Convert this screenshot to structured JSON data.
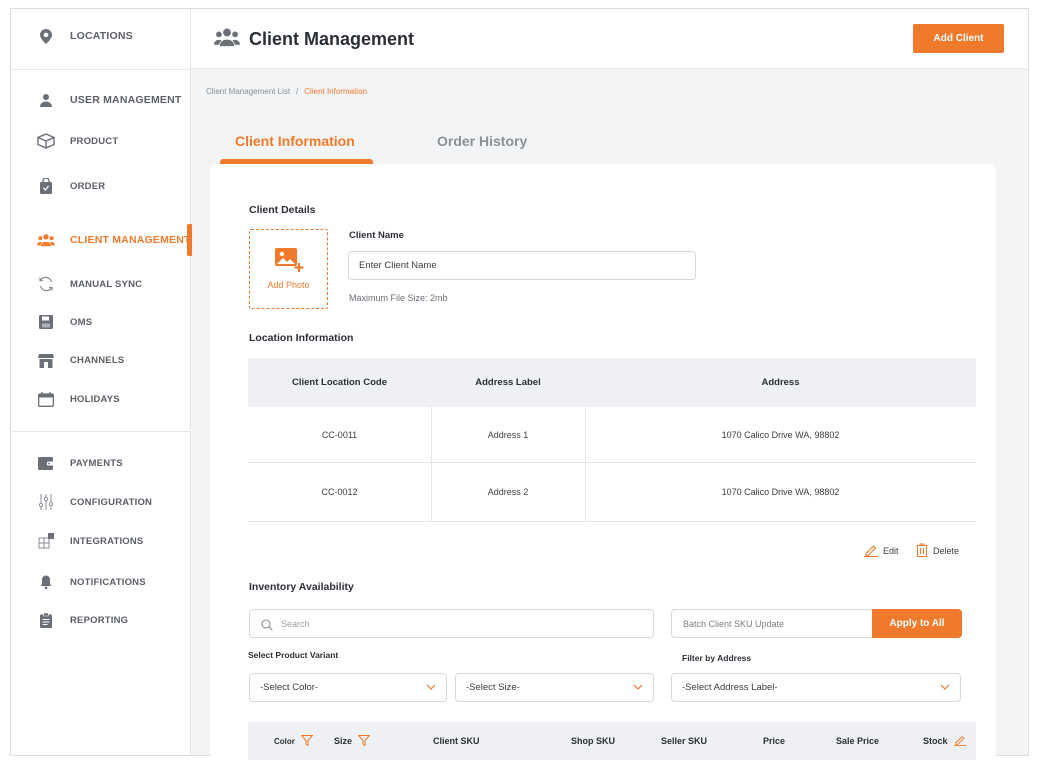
{
  "sidebar": {
    "items": [
      {
        "label": "LOCATIONS",
        "icon": "location-pin-icon"
      },
      {
        "label": "USER MANAGEMENT",
        "icon": "user-icon"
      },
      {
        "label": "PRODUCT",
        "icon": "box-icon"
      },
      {
        "label": "ORDER",
        "icon": "shopping-bag-icon"
      },
      {
        "label": "CLIENT MANAGEMENT",
        "icon": "group-icon",
        "active": true
      },
      {
        "label": "MANUAL SYNC",
        "icon": "sync-icon"
      },
      {
        "label": "OMS",
        "icon": "save-icon"
      },
      {
        "label": "CHANNELS",
        "icon": "store-icon"
      },
      {
        "label": "HOLIDAYS",
        "icon": "calendar-icon"
      },
      {
        "label": "PAYMENTS",
        "icon": "wallet-icon"
      },
      {
        "label": "CONFIGURATION",
        "icon": "sliders-icon"
      },
      {
        "label": "INTEGRATIONS",
        "icon": "puzzle-icon"
      },
      {
        "label": "NOTIFICATIONS",
        "icon": "bell-icon"
      },
      {
        "label": "REPORTING",
        "icon": "clipboard-icon"
      }
    ]
  },
  "header": {
    "title": "Client Management",
    "add_client_label": "Add Client"
  },
  "breadcrumb": {
    "parent": "Client Management List",
    "separator": "/",
    "current": "Client Information"
  },
  "tabs": [
    {
      "label": "Client Information",
      "active": true
    },
    {
      "label": "Order History",
      "active": false
    }
  ],
  "client_details": {
    "heading": "Client Details",
    "add_photo_label": "Add Photo",
    "name_label": "Client Name",
    "name_value": "Enter Client Name",
    "max_file_hint": "Maximum File Size: 2mb"
  },
  "location_info": {
    "heading": "Location Information",
    "columns": [
      "Client Location Code",
      "Address Label",
      "Address"
    ],
    "rows": [
      {
        "code": "CC-0011",
        "label": "Address 1",
        "address": "1070 Calico Drive WA, 98802"
      },
      {
        "code": "CC-0012",
        "label": "Address 2",
        "address": "1070 Calico Drive WA, 98802"
      }
    ],
    "edit_label": "Edit",
    "delete_label": "Delete"
  },
  "inventory": {
    "heading": "Inventory Availability",
    "search_placeholder": "Search",
    "batch_placeholder": "Batch Client SKU Update",
    "apply_label": "Apply to All",
    "variant_label": "Select Product Variant",
    "address_filter_label": "Filter by Address",
    "color_select": "-Select Color-",
    "size_select": "-Select Size-",
    "address_select": "-Select Address Label-",
    "columns": [
      "Color",
      "Size",
      "Client SKU",
      "Shop SKU",
      "Seller SKU",
      "Price",
      "Sale Price",
      "Stock"
    ]
  },
  "colors": {
    "accent": "#f07a2c",
    "text": "#2b2f36",
    "muted": "#5b5f66",
    "background": "#f3f4f6"
  }
}
